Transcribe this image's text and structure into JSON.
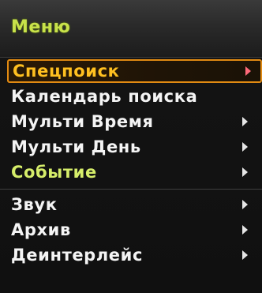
{
  "menu": {
    "title": "Меню",
    "items": [
      {
        "label": "Спецпоиск",
        "has_submenu": true,
        "state": "selected"
      },
      {
        "label": "Календарь поиска",
        "has_submenu": false,
        "state": "normal"
      },
      {
        "label": "Мульти Время",
        "has_submenu": true,
        "state": "normal"
      },
      {
        "label": "Мульти День",
        "has_submenu": true,
        "state": "normal"
      },
      {
        "label": "Событие",
        "has_submenu": true,
        "state": "highlight"
      },
      {
        "label": "Звук",
        "has_submenu": true,
        "state": "normal"
      },
      {
        "label": "Архив",
        "has_submenu": true,
        "state": "normal"
      },
      {
        "label": "Деинтерлейс",
        "has_submenu": true,
        "state": "normal"
      }
    ]
  },
  "colors": {
    "title": "#c8e24a",
    "selected_border": "#e18a12",
    "selected_text": "#ffc020",
    "item_text": "#f4f4f4",
    "highlight_text": "#d6ee6a",
    "background": "#101010"
  },
  "icons": {
    "submenu": "chevron-right-icon"
  }
}
